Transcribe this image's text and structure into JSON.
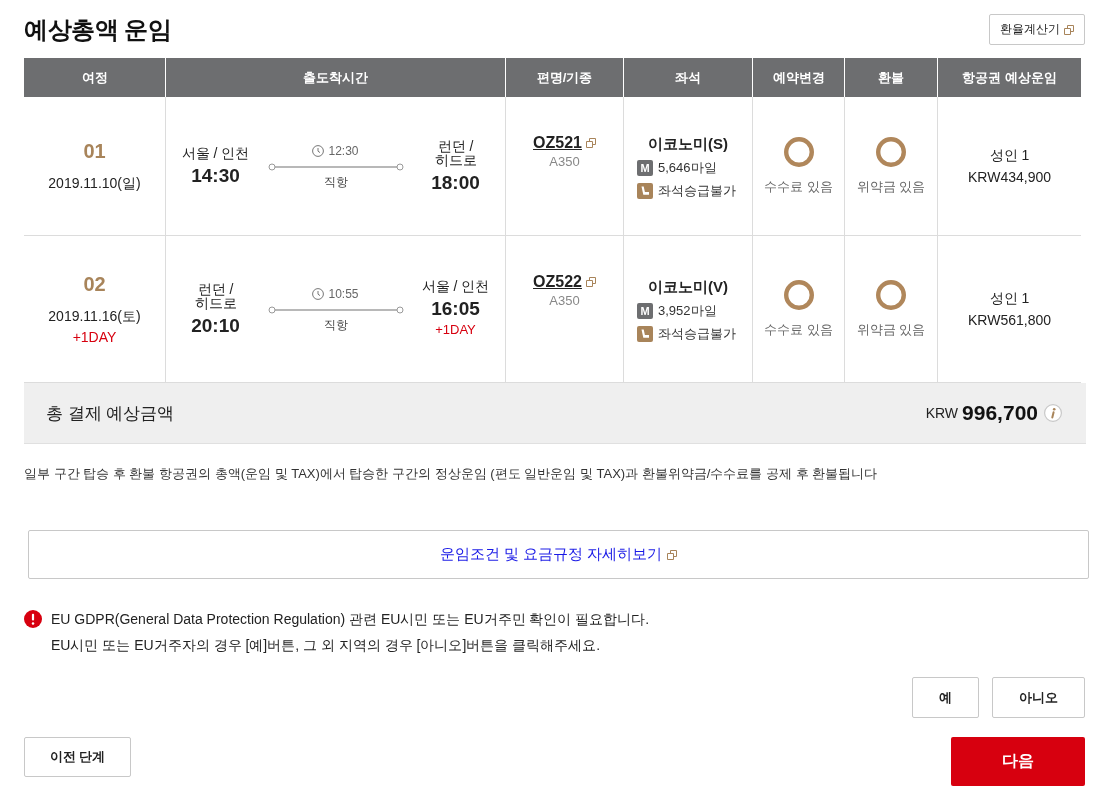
{
  "page": {
    "title": "예상총액 운임",
    "exchange_button": {
      "label": "환율계산기"
    }
  },
  "table": {
    "columns": [
      "여정",
      "출도착시간",
      "편명/기종",
      "좌석",
      "예약변경",
      "환불",
      "항공권 예상운임"
    ],
    "rows": [
      {
        "segment": "01",
        "date": "2019.11.10(일)",
        "departure": {
          "city": "서울 / 인천",
          "time": "14:30"
        },
        "duration": "12:30",
        "route_type": "직항",
        "arrival": {
          "city": "런던 / 히드로",
          "time": "18:00"
        },
        "flight": {
          "number": "OZ521",
          "aircraft": "A350"
        },
        "seat": {
          "cabin": "이코노미(S)",
          "miles_badge": "M",
          "miles": "5,646마일",
          "upgrade": "좌석승급불가"
        },
        "change": {
          "available": true,
          "label": "수수료 있음"
        },
        "refund": {
          "available": true,
          "label": "위약금 있음"
        },
        "fare": {
          "passengers": "성인 1",
          "amount": "KRW434,900"
        }
      },
      {
        "segment": "02",
        "date": "2019.11.16(토)",
        "date_note": "+1DAY",
        "departure": {
          "city": "런던 / 히드로",
          "time": "20:10"
        },
        "duration": "10:55",
        "route_type": "직항",
        "arrival": {
          "city": "서울 / 인천",
          "time": "16:05",
          "day_change": "+1DAY"
        },
        "flight": {
          "number": "OZ522",
          "aircraft": "A350"
        },
        "seat": {
          "cabin": "이코노미(V)",
          "miles_badge": "M",
          "miles": "3,952마일",
          "upgrade": "좌석승급불가"
        },
        "change": {
          "available": true,
          "label": "수수료 있음"
        },
        "refund": {
          "available": true,
          "label": "위약금 있음"
        },
        "fare": {
          "passengers": "성인 1",
          "amount": "KRW561,800"
        }
      }
    ]
  },
  "total": {
    "label": "총 결제 예상금액",
    "currency": "KRW",
    "amount": "996,700"
  },
  "refund_note": "일부 구간 탑승 후 환불 항공권의 총액(운임 및 TAX)에서 탑승한 구간의 정상운임 (편도 일반운임 및 TAX)과 환불위약금/수수료를 공제 후 환불됩니다",
  "fare_rules_link": "운임조건 및 요금규정 자세히보기",
  "gdpr": {
    "lines": [
      "EU GDPR(General Data Protection Regulation) 관련 EU시민 또는 EU거주민 확인이 필요합니다.",
      "EU시민 또는 EU거주자의 경우 [예]버튼, 그 외 지역의 경우 [아니오]버튼을 클릭해주세요."
    ],
    "buttons": [
      "예",
      "아니오"
    ]
  },
  "navigation": {
    "back": "이전 단계",
    "next": "다음"
  }
}
